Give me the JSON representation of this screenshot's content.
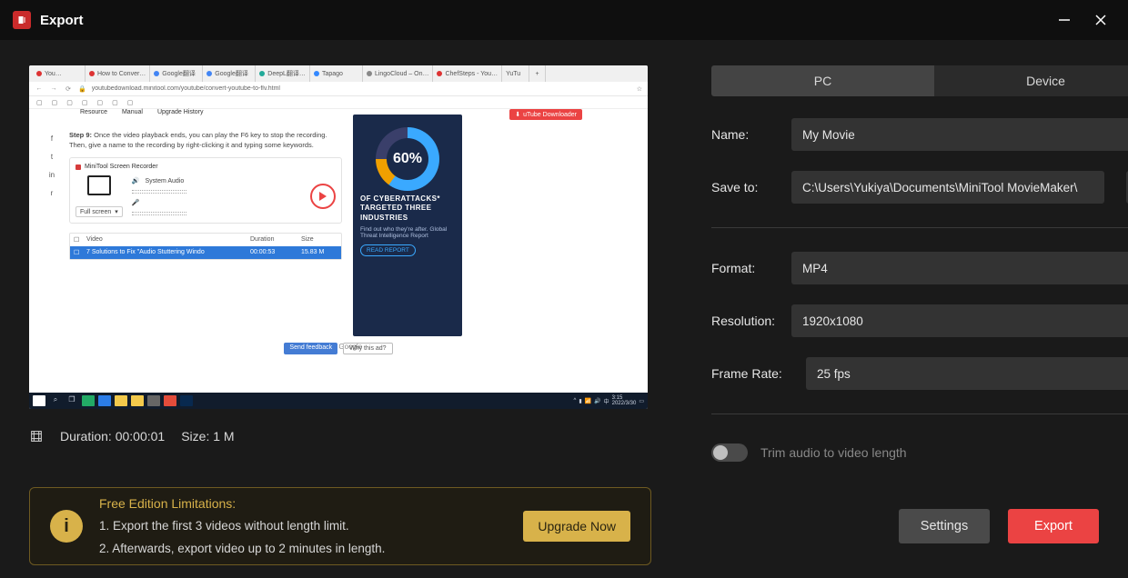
{
  "titlebar": {
    "title": "Export"
  },
  "tabs": {
    "pc": "PC",
    "device": "Device"
  },
  "form": {
    "name_label": "Name:",
    "name_value": "My Movie",
    "saveto_label": "Save to:",
    "saveto_value": "C:\\Users\\Yukiya\\Documents\\MiniTool MovieMaker\\",
    "format_label": "Format:",
    "format_value": "MP4",
    "resolution_label": "Resolution:",
    "resolution_value": "1920x1080",
    "framerate_label": "Frame Rate:",
    "framerate_value": "25 fps",
    "trim_label": "Trim audio to video length"
  },
  "meta": {
    "duration_label": "Duration:",
    "duration_value": "00:00:01",
    "size_label": "Size:",
    "size_value": "1 M"
  },
  "limits": {
    "title": "Free Edition Limitations:",
    "line1": "1. Export the first 3 videos without length limit.",
    "line2": "2. Afterwards, export video up to 2 minutes in length.",
    "upgrade": "Upgrade Now"
  },
  "actions": {
    "settings": "Settings",
    "export": "Export"
  },
  "preview": {
    "url": "youtubedownload.minitool.com/youtube/convert-youtube-to-flv.html",
    "nav": {
      "resource": "Resource",
      "manual": "Manual",
      "history": "Upgrade History"
    },
    "downloader_btn": "uTube Downloader",
    "step_bold": "Step 9:",
    "step_text": "Once the video playback ends, you can play the F6 key to stop the recording. Then, give a name to the recording by right-clicking it and typing some keywords.",
    "rec_title": "MiniTool Screen Recorder",
    "system_audio": "System Audio",
    "fullscreen": "Full screen",
    "file_cols": {
      "video": "Video",
      "duration": "Duration",
      "size": "Size"
    },
    "file_row": {
      "name": "7 Solutions to Fix \"Audio Stuttering Windo",
      "duration": "00:00:53",
      "size": "15.83 M"
    },
    "ad_pct": "60%",
    "ad_head": "OF CYBERATTACKS* TARGETED THREE INDUSTRIES",
    "ad_sub": "Find out who they're after. Global Threat Intelligence Report",
    "ad_read": "READ REPORT",
    "adsby": "Ads by Google",
    "send_feedback": "Send feedback",
    "why_ad": "Why this ad?"
  }
}
